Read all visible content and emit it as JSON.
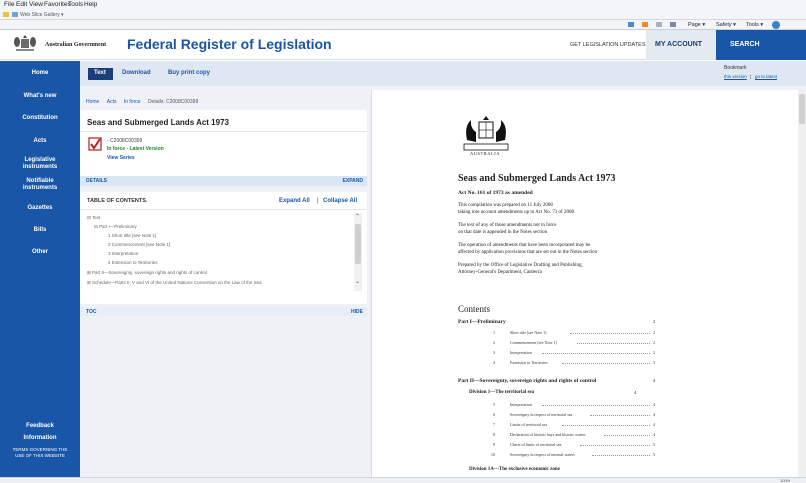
{
  "browser": {
    "menu": [
      "File",
      "Edit",
      "View",
      "Favorites",
      "Tools",
      "Help"
    ],
    "favorites": "Web Slice Gallery ▾",
    "commands": [
      "Page ▾",
      "Safety ▾",
      "Tools ▾"
    ],
    "zoom": "100%"
  },
  "header": {
    "gov": "Australian Government",
    "title": "Federal Register of Legislation",
    "updates": "GET LEGISLATION UPDATES",
    "account": "MY ACCOUNT",
    "search": "SEARCH"
  },
  "sidebar": {
    "items": [
      "Home",
      "What's new",
      "Constitution",
      "Acts",
      "Legislative instruments",
      "Notifiable instruments",
      "Gazettes",
      "Bills",
      "Other"
    ],
    "bottom": [
      "Feedback",
      "Information",
      "TERMS GOVERNING THE USE OF THIS WEBSITE"
    ]
  },
  "tabs": {
    "text": "Text",
    "download": "Download",
    "print": "Buy print copy"
  },
  "bookmark": {
    "label": "Bookmark",
    "this_version": "this version",
    "separator": "|",
    "latest": "go to latest"
  },
  "breadcrumb": [
    "Home",
    "Acts",
    "In force",
    "Details: C2008C00399"
  ],
  "act": {
    "title": "Seas and Submerged Lands Act 1973",
    "id": "- C2008C00399",
    "status": "In force - Latest Version",
    "series": "View Series"
  },
  "details": {
    "label": "DETAILS",
    "expand": "EXPAND"
  },
  "toc": {
    "title": "TABLE OF CONTENTS.",
    "expand_all": "Expand All",
    "separator": "|",
    "collapse_all": "Collapse All",
    "items": [
      "⊟ Text",
      "⊟ Part I—Preliminary",
      "1 Short title [see Note 1]",
      "2 Commencement [see Note 1]",
      "3 Interpretation",
      "4 Extension to Territories",
      "⊞ Part II—Sovereignty, sovereign rights and rights of control",
      "⊞ Schedule—Parts II, V and VI of the United Nations Convention on the Law of the Sea"
    ],
    "footer_left": "TOC",
    "footer_right": "HIDE"
  },
  "document": {
    "crest_label": "AUSTRALIA",
    "title": "Seas and Submerged Lands Act 1973",
    "subtitle": "Act No. 161 of 1973 as amended",
    "para1a": "This compilation was prepared on 11 July 2008",
    "para1b": "taking into account amendments up to Act No. 73 of 2008",
    "para2a": "The text of any of those amendments not in force",
    "para2b": "on that date is appended in the Notes section",
    "para3a": "The operation of amendments that have been incorporated may be",
    "para3b": "affected by application provisions that are set out in the Notes section",
    "para4a": "Prepared by the Office of Legislative Drafting and Publishing,",
    "para4b": "Attorney-General's Department, Canberra",
    "contents_heading": "Contents",
    "part1": {
      "title": "Part I—Preliminary",
      "page": "2"
    },
    "part1_rows": [
      {
        "num": "1",
        "text": "Short title [see Note 1]",
        "page": "2"
      },
      {
        "num": "2",
        "text": "Commencement [see Note 1]",
        "page": "2"
      },
      {
        "num": "3",
        "text": "Interpretation",
        "page": "2"
      },
      {
        "num": "4",
        "text": "Extension to Territories",
        "page": "3"
      }
    ],
    "part2": {
      "title": "Part II—Sovereignty, sovereign rights and rights of control",
      "page": "4"
    },
    "division1": {
      "title": "Division 1—The territorial sea",
      "page": "4"
    },
    "div1_rows": [
      {
        "num": "5",
        "text": "Interpretation",
        "page": "4"
      },
      {
        "num": "6",
        "text": "Sovereignty in respect of territorial sea",
        "page": "4"
      },
      {
        "num": "7",
        "text": "Limits of territorial sea",
        "page": "4"
      },
      {
        "num": "8",
        "text": "Declaration of historic bays and historic waters",
        "page": "4"
      },
      {
        "num": "9",
        "text": "Charts of limits of territorial sea",
        "page": "5"
      },
      {
        "num": "10",
        "text": "Sovereignty in respect of internal waters",
        "page": "5"
      }
    ],
    "division1a": "Division 1A—The exclusive economic zone"
  }
}
